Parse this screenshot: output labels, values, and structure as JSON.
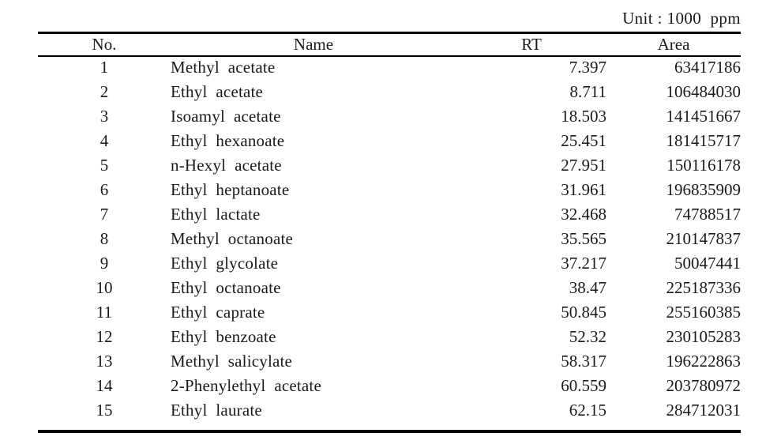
{
  "caption": {
    "unit_note": "Unit : 1000  ppm"
  },
  "table": {
    "columns": [
      {
        "key": "no",
        "label": "No."
      },
      {
        "key": "name",
        "label": "Name"
      },
      {
        "key": "rt",
        "label": "RT"
      },
      {
        "key": "area",
        "label": "Area"
      }
    ],
    "rows": [
      {
        "no": "1",
        "name": "Methyl  acetate",
        "rt": "7.397",
        "area": "63417186"
      },
      {
        "no": "2",
        "name": "Ethyl  acetate",
        "rt": "8.711",
        "area": "106484030"
      },
      {
        "no": "3",
        "name": "Isoamyl  acetate",
        "rt": "18.503",
        "area": "141451667"
      },
      {
        "no": "4",
        "name": "Ethyl  hexanoate",
        "rt": "25.451",
        "area": "181415717"
      },
      {
        "no": "5",
        "name": "n-Hexyl  acetate",
        "rt": "27.951",
        "area": "150116178"
      },
      {
        "no": "6",
        "name": "Ethyl  heptanoate",
        "rt": "31.961",
        "area": "196835909"
      },
      {
        "no": "7",
        "name": "Ethyl  lactate",
        "rt": "32.468",
        "area": "74788517"
      },
      {
        "no": "8",
        "name": "Methyl  octanoate",
        "rt": "35.565",
        "area": "210147837"
      },
      {
        "no": "9",
        "name": "Ethyl  glycolate",
        "rt": "37.217",
        "area": "50047441"
      },
      {
        "no": "10",
        "name": "Ethyl  octanoate",
        "rt": "38.47",
        "area": "225187336"
      },
      {
        "no": "11",
        "name": "Ethyl  caprate",
        "rt": "50.845",
        "area": "255160385"
      },
      {
        "no": "12",
        "name": "Ethyl  benzoate",
        "rt": "52.32",
        "area": "230105283"
      },
      {
        "no": "13",
        "name": "Methyl  salicylate",
        "rt": "58.317",
        "area": "196222863"
      },
      {
        "no": "14",
        "name": "2-Phenylethyl  acetate",
        "rt": "60.559",
        "area": "203780972"
      },
      {
        "no": "15",
        "name": "Ethyl  laurate",
        "rt": "62.15",
        "area": "284712031"
      }
    ]
  },
  "style": {
    "rule_color": "#000000",
    "text_color": "#1a1a1a",
    "background": "#ffffff"
  }
}
